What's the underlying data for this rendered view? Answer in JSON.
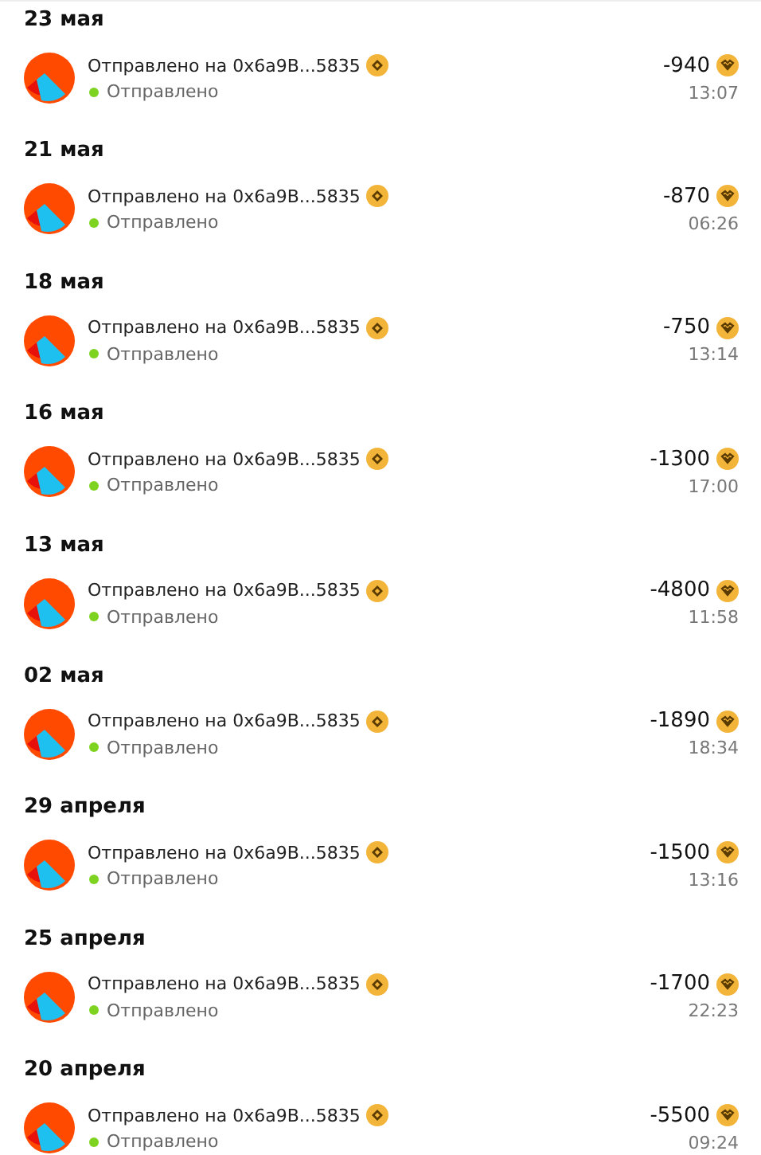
{
  "groups": [
    {
      "date": "23 мая",
      "tx": [
        {
          "title": "Отправлено на 0x6a9B...5835",
          "status": "Отправлено",
          "amount": "-940",
          "time": "13:07"
        }
      ]
    },
    {
      "date": "21 мая",
      "tx": [
        {
          "title": "Отправлено на 0x6a9B...5835",
          "status": "Отправлено",
          "amount": "-870",
          "time": "06:26"
        }
      ]
    },
    {
      "date": "18 мая",
      "tx": [
        {
          "title": "Отправлено на 0x6a9B...5835",
          "status": "Отправлено",
          "amount": "-750",
          "time": "13:14"
        }
      ]
    },
    {
      "date": "16 мая",
      "tx": [
        {
          "title": "Отправлено на 0x6a9B...5835",
          "status": "Отправлено",
          "amount": "-1300",
          "time": "17:00"
        }
      ]
    },
    {
      "date": "13 мая",
      "tx": [
        {
          "title": "Отправлено на 0x6a9B...5835",
          "status": "Отправлено",
          "amount": "-4800",
          "time": "11:58"
        }
      ]
    },
    {
      "date": "02 мая",
      "tx": [
        {
          "title": "Отправлено на 0x6a9B...5835",
          "status": "Отправлено",
          "amount": "-1890",
          "time": "18:34"
        }
      ]
    },
    {
      "date": "29 апреля",
      "tx": [
        {
          "title": "Отправлено на 0x6a9B...5835",
          "status": "Отправлено",
          "amount": "-1500",
          "time": "13:16"
        }
      ]
    },
    {
      "date": "25 апреля",
      "tx": [
        {
          "title": "Отправлено на 0x6a9B...5835",
          "status": "Отправлено",
          "amount": "-1700",
          "time": "22:23"
        }
      ]
    },
    {
      "date": "20 апреля",
      "tx": [
        {
          "title": "Отправлено на 0x6a9B...5835",
          "status": "Отправлено",
          "amount": "-5500",
          "time": "09:24"
        }
      ]
    }
  ]
}
